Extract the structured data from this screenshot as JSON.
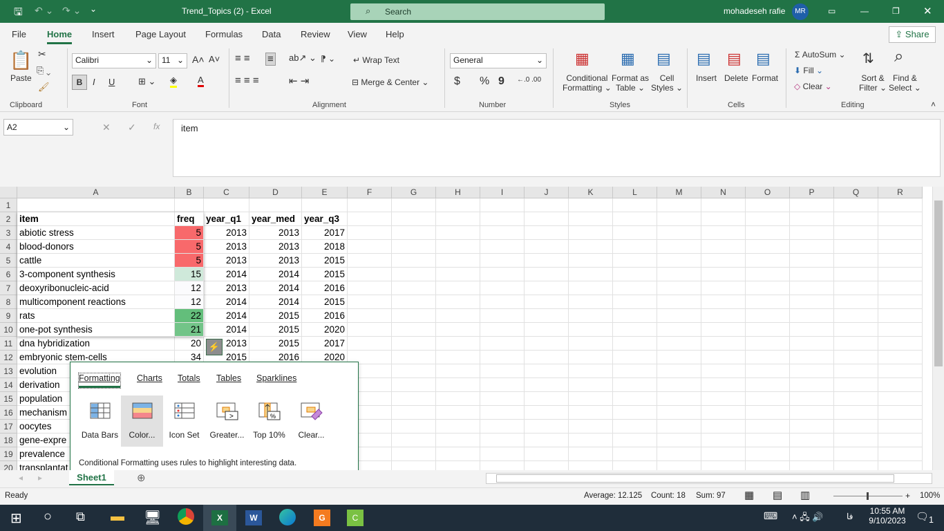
{
  "titlebar": {
    "doc_title": "Trend_Topics (2)  -  Excel",
    "search_placeholder": "Search",
    "user": "mohadeseh rafie",
    "initials": "MR"
  },
  "menu": {
    "tabs": [
      "File",
      "Home",
      "Insert",
      "Page Layout",
      "Formulas",
      "Data",
      "Review",
      "View",
      "Help"
    ],
    "active": "Home",
    "share": "Share"
  },
  "ribbon": {
    "clipboard": {
      "paste": "Paste",
      "group": "Clipboard"
    },
    "font": {
      "name": "Calibri",
      "size": "11",
      "bold": "B",
      "italic": "I",
      "underline": "U",
      "group": "Font"
    },
    "alignment": {
      "wrap": "Wrap Text",
      "merge": "Merge & Center",
      "group": "Alignment"
    },
    "number": {
      "format": "General",
      "currency": "$",
      "percent": "%",
      "comma": "9",
      "group": "Number"
    },
    "styles": {
      "conditional": "Conditional",
      "conditional2": "Formatting",
      "format_table": "Format as",
      "format_table2": "Table",
      "cell_styles": "Cell",
      "cell_styles2": "Styles",
      "group": "Styles"
    },
    "cells": {
      "insert": "Insert",
      "delete": "Delete",
      "format": "Format",
      "group": "Cells"
    },
    "editing": {
      "autosum": "AutoSum",
      "fill": "Fill",
      "clear": "Clear",
      "sort": "Sort &",
      "sort2": "Filter",
      "find": "Find &",
      "find2": "Select",
      "group": "Editing"
    }
  },
  "formula_bar": {
    "name_box": "A2",
    "fx": "fx",
    "value": "item"
  },
  "columns": [
    "A",
    "B",
    "C",
    "D",
    "E",
    "F",
    "G",
    "H",
    "I",
    "J",
    "K",
    "L",
    "M",
    "N",
    "O",
    "P",
    "Q",
    "R"
  ],
  "rows": [
    [],
    [
      "item",
      "freq",
      "year_q1",
      "year_med",
      "year_q3"
    ],
    [
      "abiotic stress",
      "5",
      "2013",
      "2013",
      "2017"
    ],
    [
      "blood-donors",
      "5",
      "2013",
      "2013",
      "2018"
    ],
    [
      "cattle",
      "5",
      "2013",
      "2013",
      "2015"
    ],
    [
      "3-component synthesis",
      "15",
      "2014",
      "2014",
      "2015"
    ],
    [
      "deoxyribonucleic-acid",
      "12",
      "2013",
      "2014",
      "2016"
    ],
    [
      "multicomponent reactions",
      "12",
      "2014",
      "2014",
      "2015"
    ],
    [
      "rats",
      "22",
      "2014",
      "2015",
      "2016"
    ],
    [
      "one-pot synthesis",
      "21",
      "2014",
      "2015",
      "2020"
    ],
    [
      "dna hybridization",
      "20",
      "2013",
      "2015",
      "2017"
    ],
    [
      "embryonic stem-cells",
      "34",
      "2015",
      "2016",
      "2020"
    ],
    [
      "evolution"
    ],
    [
      "derivation"
    ],
    [
      "population"
    ],
    [
      "mechanism"
    ],
    [
      "oocytes"
    ],
    [
      "gene-expre"
    ],
    [
      "prevalence"
    ],
    [
      "transplantat"
    ]
  ],
  "freq_colors": {
    "3": "#f8696b",
    "4": "#f8696b",
    "5": "#f8696b",
    "6": "#cfe9da",
    "7": "#fbfbfd",
    "8": "#fbfbfd",
    "9": "#63be7b",
    "10": "#72c488"
  },
  "quick_analysis": {
    "tabs": [
      "Formatting",
      "Charts",
      "Totals",
      "Tables",
      "Sparklines"
    ],
    "active_tab": "Formatting",
    "items": [
      "Data Bars",
      "Color...",
      "Icon Set",
      "Greater...",
      "Top 10%",
      "Clear..."
    ],
    "selected": "Color...",
    "description": "Conditional Formatting uses rules to highlight interesting data."
  },
  "sheets": {
    "tabs": [
      "Sheet1"
    ],
    "active": "Sheet1"
  },
  "status": {
    "ready": "Ready",
    "average": "Average: 12.125",
    "count": "Count: 18",
    "sum": "Sum: 97",
    "zoom": "100%"
  },
  "taskbar": {
    "time": "10:55 AM",
    "date": "9/10/2023",
    "lang": "فا",
    "notifications": "1"
  },
  "colors": {
    "accent": "#217346"
  }
}
